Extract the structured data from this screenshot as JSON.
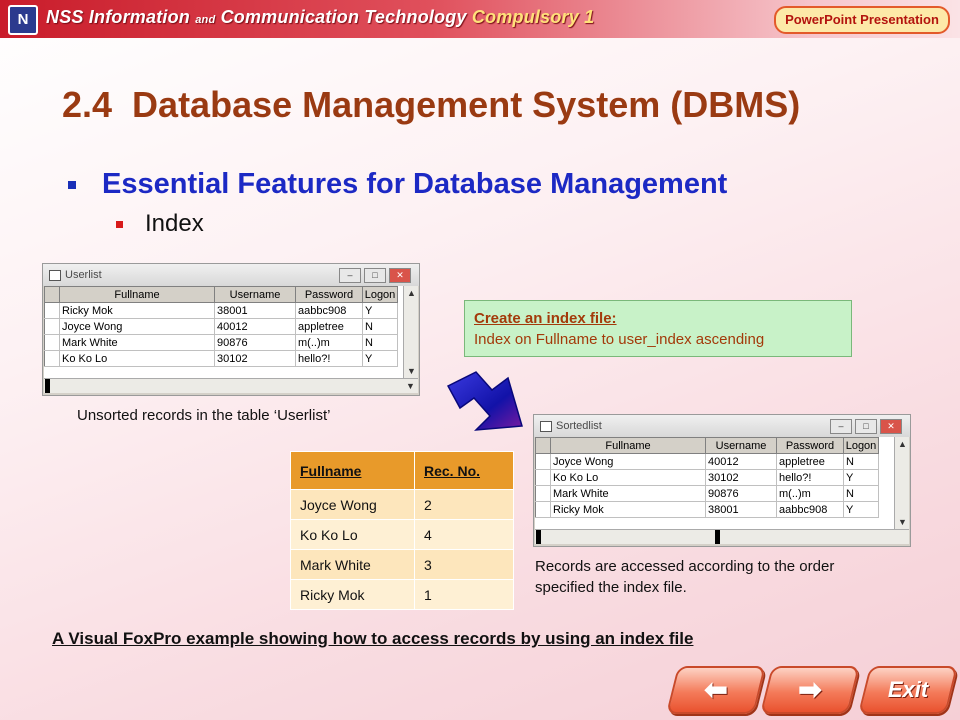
{
  "header": {
    "logo_text": "N",
    "title_part1": "NSS Information",
    "title_and": "and",
    "title_part2": "Communication Technology",
    "title_accent": "Compulsory 1",
    "badge": "PowerPoint Presentation"
  },
  "slide": {
    "title": "2.4  Database Management System (DBMS)",
    "bullet1": "Essential Features for Database Management",
    "bullet2": "Index"
  },
  "userlist": {
    "title": "Userlist",
    "buttons": [
      "–",
      "□",
      "✕"
    ],
    "columns": [
      "Fullname",
      "Username",
      "Password",
      "Logon"
    ],
    "rows": [
      [
        "Ricky Mok",
        "38001",
        "aabbc908",
        "Y"
      ],
      [
        "Joyce Wong",
        "40012",
        "appletree",
        "N"
      ],
      [
        "Mark White",
        "90876",
        "m(..)m",
        "N"
      ],
      [
        "Ko Ko Lo",
        "30102",
        "hello?!",
        "Y"
      ]
    ],
    "caption": "Unsorted records in the table ‘Userlist’"
  },
  "callout": {
    "title": "Create an index file:",
    "text": "Index on Fullname to user_index ascending"
  },
  "sortedlist": {
    "title": "Sortedlist",
    "buttons": [
      "–",
      "□",
      "✕"
    ],
    "columns": [
      "Fullname",
      "Username",
      "Password",
      "Logon"
    ],
    "rows": [
      [
        "Joyce Wong",
        "40012",
        "appletree",
        "N"
      ],
      [
        "Ko Ko Lo",
        "30102",
        "hello?!",
        "Y"
      ],
      [
        "Mark White",
        "90876",
        "m(..)m",
        "N"
      ],
      [
        "Ricky Mok",
        "38001",
        "aabbc908",
        "Y"
      ]
    ],
    "caption_line1": "Records are accessed according to the order",
    "caption_line2": "specified the index file."
  },
  "index_table": {
    "headers": [
      "Fullname",
      "Rec. No."
    ],
    "rows": [
      [
        "Joyce Wong",
        "2"
      ],
      [
        "Ko Ko Lo",
        "4"
      ],
      [
        "Mark White",
        "3"
      ],
      [
        "Ricky Mok",
        "1"
      ]
    ]
  },
  "footer_note": "A Visual FoxPro example showing how to access records by using an index file",
  "nav": {
    "back": "⬅",
    "forward": "➡",
    "exit": "Exit"
  }
}
